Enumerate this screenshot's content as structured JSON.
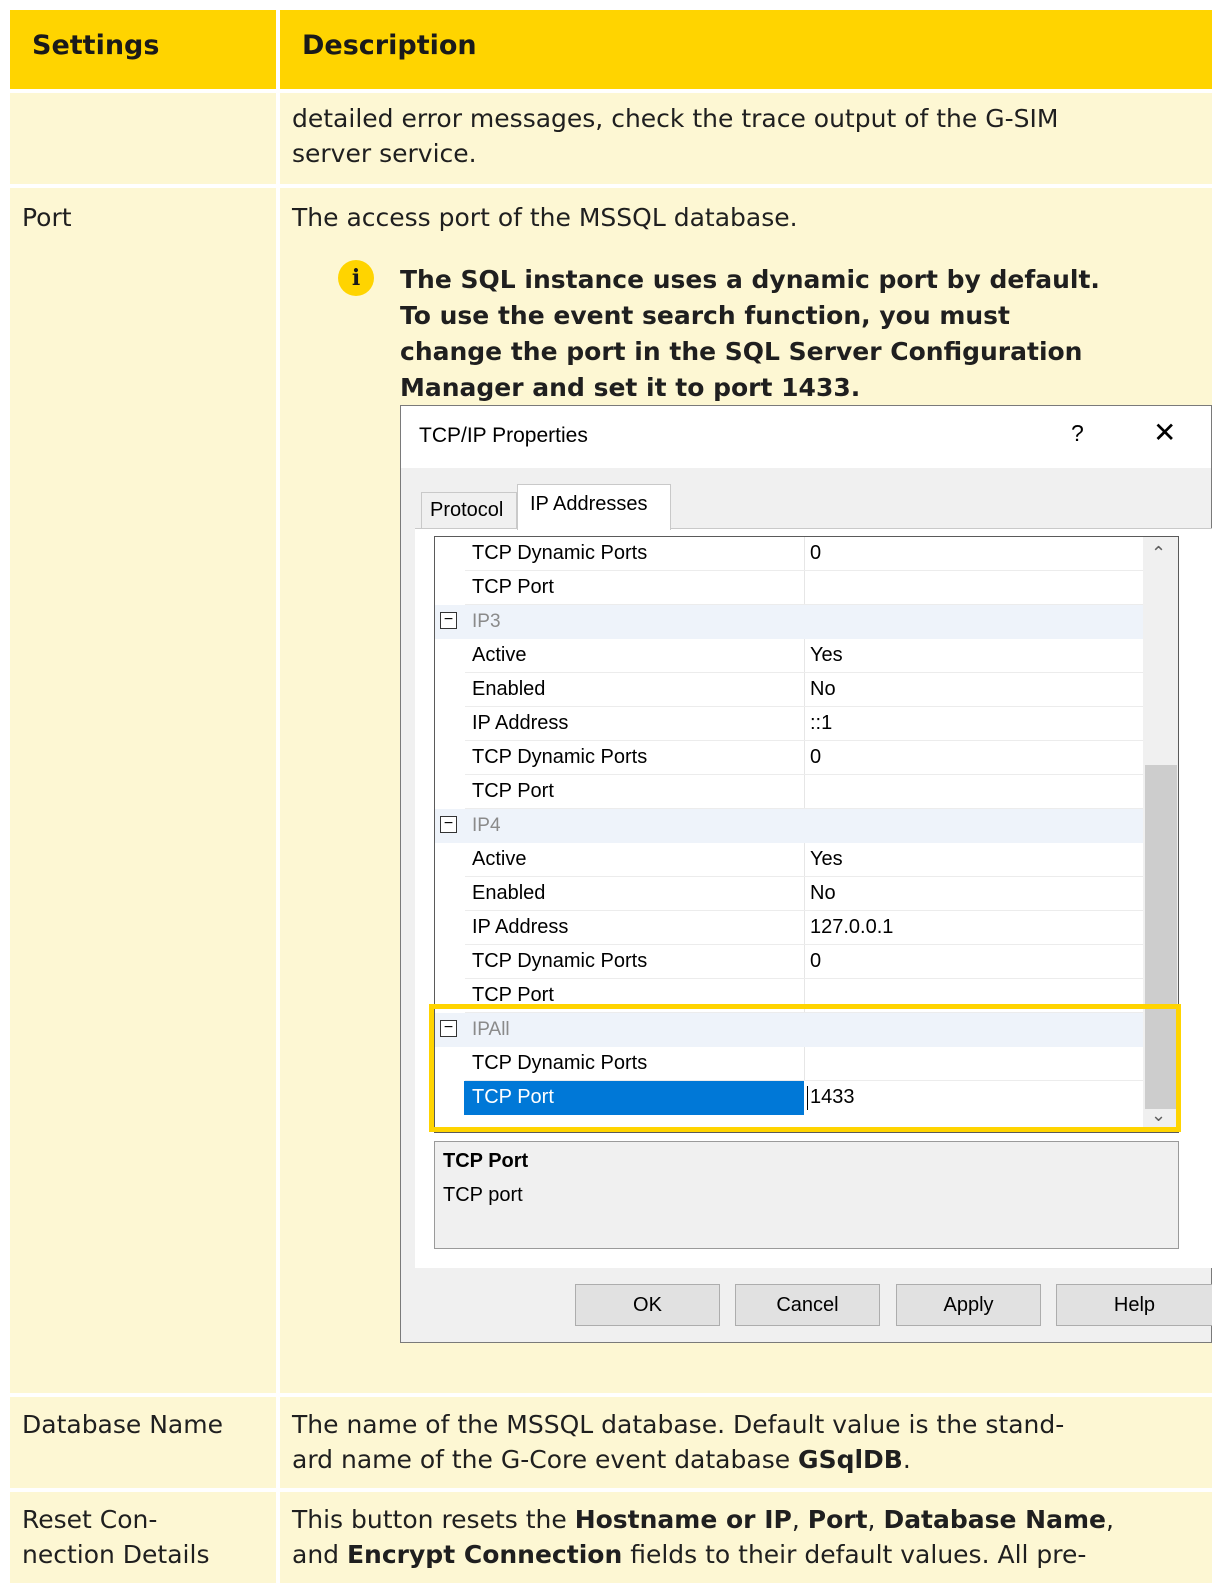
{
  "table": {
    "header": {
      "settings": "Settings",
      "description": "Description"
    },
    "row0": {
      "desc_line1": "detailed error messages, check the trace output of the G-SIM",
      "desc_line2": "server service."
    },
    "row_port": {
      "setting": "Port",
      "desc": "The access port of the MSSQL database.",
      "note_line1": "The SQL instance uses a dynamic port by default.",
      "note_line2": "To use the event search function, you must",
      "note_line3": "change the port in the SQL Server Configuration",
      "note_line4": "Manager and set it to port 1433."
    },
    "row_dbname": {
      "setting": "Database Name",
      "desc_line1": "The name of the MSSQL database. Default value is the stand-",
      "desc_line2_pre": "ard name of the G-Core event database ",
      "desc_line2_bold": "GSqlDB",
      "desc_line2_post": "."
    },
    "row_reset": {
      "setting_line1": "Reset Con-",
      "setting_line2": "nection Details",
      "desc_line1_pre": "This button resets the ",
      "desc_line1_b1": "Hostname or IP",
      "desc_line1_sep1": ", ",
      "desc_line1_b2": "Port",
      "desc_line1_sep2": ", ",
      "desc_line1_b3": "Database Name",
      "desc_line1_post": ",",
      "desc_line2_pre": "and ",
      "desc_line2_b": "Encrypt Connection",
      "desc_line2_post": " fields to their default values. All pre-"
    }
  },
  "dialog": {
    "title": "TCP/IP Properties",
    "help_glyph": "?",
    "close_glyph": "✕",
    "tabs": [
      "Protocol",
      "IP Addresses"
    ],
    "rows": [
      {
        "name": "TCP Dynamic Ports",
        "value": "0"
      },
      {
        "name": "TCP Port",
        "value": ""
      },
      {
        "group": "IP3"
      },
      {
        "name": "Active",
        "value": "Yes"
      },
      {
        "name": "Enabled",
        "value": "No"
      },
      {
        "name": "IP Address",
        "value": "::1"
      },
      {
        "name": "TCP Dynamic Ports",
        "value": "0"
      },
      {
        "name": "TCP Port",
        "value": ""
      },
      {
        "group": "IP4"
      },
      {
        "name": "Active",
        "value": "Yes"
      },
      {
        "name": "Enabled",
        "value": "No"
      },
      {
        "name": "IP Address",
        "value": "127.0.0.1"
      },
      {
        "name": "TCP Dynamic Ports",
        "value": "0"
      },
      {
        "name": "TCP Port",
        "value": ""
      },
      {
        "group": "IPAll"
      },
      {
        "name": "TCP Dynamic Ports",
        "value": ""
      },
      {
        "name": "TCP Port",
        "value": "1433",
        "selected": true
      }
    ],
    "description_title": "TCP Port",
    "description_text": "TCP port",
    "buttons": {
      "ok": "OK",
      "cancel": "Cancel",
      "apply": "Apply",
      "help": "Help"
    }
  },
  "icons": {
    "info": "info-icon",
    "toggle": "minus-box-icon",
    "scroll_up": "chevron-up-icon",
    "scroll_down": "chevron-down-icon"
  },
  "colors": {
    "header": "#ffd400",
    "row_bg": "#fdf7d3",
    "highlight": "#ffd400",
    "selection": "#0078d7"
  }
}
